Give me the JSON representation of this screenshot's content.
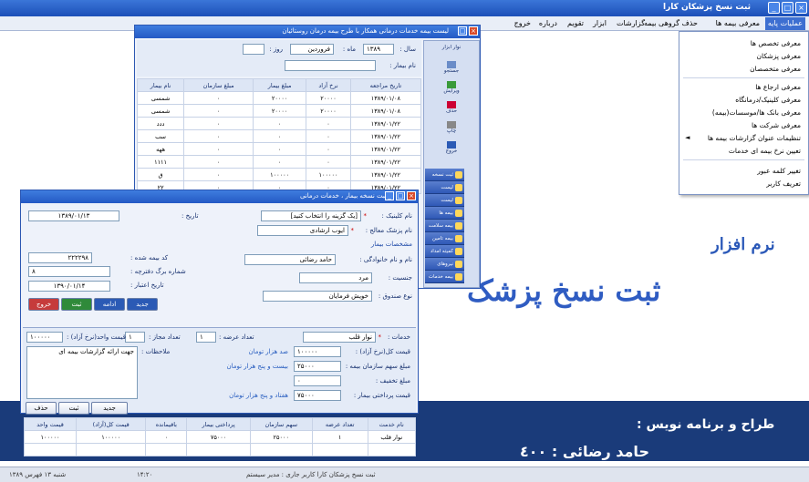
{
  "app": {
    "title": "ثبت نسخ پزشکان   کارا",
    "window_controls": [
      "_",
      "□",
      "×"
    ]
  },
  "menu": [
    "عملیات پایه",
    "معرفی بیمه ها",
    "حذف گروهی بیمه",
    "گزارشات",
    "ابزار",
    "تقویم",
    "درباره",
    "خروج"
  ],
  "dropdown": {
    "items": [
      "معرفی تخصص ها",
      "معرفی پزشکان",
      "معرفی متخصصان",
      "معرفی ارجاع ها",
      "معرفی کلینیک/درمانگاه",
      "معرفی بانک ها/موسسات(بیمه)",
      "معرفی شرکت ها",
      "تنظیمات عنوان گزارشات بیمه ها",
      "تعیین نرخ بیمه ای خدمات",
      "تغییر کلمه عبور",
      "تعریف کاربر"
    ]
  },
  "brand": {
    "line1": "نرم افزار",
    "line2": "ثبت نسخ پزشک"
  },
  "footer": {
    "designer_label": "طراح و برنامه نویس :",
    "designer_name": "حامد رضائی : ٤٠٠",
    "status_left": "شنبه ۱۳ فهرس ۱۳۸۹",
    "status_time": "۱۴:۲۰",
    "status_right": "ثبت نسخ پزشکان  کارا کاربر جاری : مدیر سیستم"
  },
  "back_window": {
    "title": "لیست بیمه خدمات درمانی همکار با طرح بیمه درمان روستائیان",
    "year_label": "سال :",
    "year_value": "۱۳۸۹",
    "month_label": "ماه :",
    "month_value": "فروردین",
    "day_label": "روز :",
    "name_label": "نام بیمار :",
    "columns": [
      "تاریخ مراجعه",
      "نرخ آزاد",
      "مبلغ بیمار",
      "مبلغ سازمان",
      "نام بیمار"
    ],
    "rows": [
      [
        "۱۳۸۹/۰۱/۰۸",
        "۲۰۰۰۰",
        "۲۰۰۰۰",
        "۰",
        "شمسی"
      ],
      [
        "۱۳۸۹/۰۱/۰۸",
        "۲۰۰۰۰",
        "۲۰۰۰۰",
        "۰",
        "شمسی"
      ],
      [
        "۱۳۸۹/۰۱/۲۲",
        "۰",
        "۰",
        "۰",
        "ددد"
      ],
      [
        "۱۳۸۹/۰۱/۲۲",
        "۰",
        "۰",
        "۰",
        "سب"
      ],
      [
        "۱۳۸۹/۰۱/۲۲",
        "۰",
        "۰",
        "۰",
        "ههه"
      ],
      [
        "۱۳۸۹/۰۱/۲۲",
        "۰",
        "۰",
        "۰",
        "۱۱۱۱"
      ],
      [
        "۱۳۸۹/۰۱/۲۲",
        "۱۰۰۰۰۰",
        "۱۰۰۰۰۰",
        "۰",
        "ق"
      ],
      [
        "۱۳۸۹/۰۱/۲۲",
        "۰",
        "۰",
        "۰",
        "۲۲"
      ]
    ],
    "side_items": [
      "نوار ابزار",
      "جستجو",
      "ویرایش",
      "حذف",
      "چاپ",
      "خروج"
    ],
    "nav_rows": [
      "ثبت نسخه جدید",
      "لیست بیماران",
      "لیست پزشکان",
      "بیمه ها",
      "بیمه سلامت",
      "بیمه تامین",
      "کمیته امداد",
      "نیروهای مسلح",
      "بیمه خدمات"
    ]
  },
  "front_window": {
    "title": "ثبت نسخه بیمار  ،  خدمات درمانی",
    "date_label": "تاریخ :",
    "date_value": "۱۳۸۹/۰۱/۱۳",
    "clinic_label": "نام کلینیک :",
    "clinic_value": "[یک گزینه را انتخاب کنید]",
    "doctor_label": "نام پزشک معالج :",
    "doctor_value": "ایوب ارشادی",
    "patient_section": "مشخصات بیمار",
    "insurance_code_label": "کد بیمه شده :",
    "insurance_code_value": "۲۲۲۲۹۸",
    "booklet_label": "شماره برگ دفترچه :",
    "booklet_value": "۸",
    "name_label": "نام و نام خانوادگی :",
    "name_value": "حامد رضائی",
    "validity_label": "تاریخ اعتبار :",
    "validity_value": "۱۳۹۰/۰۱/۱۴",
    "gender_label": "جنسیت :",
    "gender_value": "مرد",
    "fund_label": "نوع صندوق :",
    "fund_value": "خویش فرمایان",
    "btn_new": "جدید",
    "btn_edit": "ادامه",
    "btn_save": "ثبت",
    "btn_exit": "خروج",
    "services_label": "خدمات :",
    "service_value": "نوار قلب",
    "count_label": "تعداد عرضه :",
    "count_value": "۱",
    "approved_label": "تعداد مجاز :",
    "approved_value": "۱",
    "unit_price_label": "قیمت واحد(نرخ آزاد) :",
    "unit_price_value": "۱۰۰۰۰۰",
    "free_price_label": "قیمت کل(نرخ آزاد) :",
    "free_price_value": "۱۰۰۰۰۰",
    "free_price_words": "صد هزار تومان",
    "org_share_label": "مبلغ سهم سازمان بیمه :",
    "org_share_value": "۲۵۰۰۰",
    "org_share_words": "بیست و پنج هزار تومان",
    "discount_label": "مبلغ تخفیف :",
    "discount_value": "۰",
    "patient_pay_label": "قیمت پرداختی بیمار :",
    "patient_pay_value": "۷۵۰۰۰",
    "patient_pay_words": "هفتاد و پنج هزار تومان",
    "notes_label": "ملاحظات :",
    "notes_value": "جهت ارائه گزارشات بیمه ای",
    "btn_add": "جدید",
    "btn_record": "ثبت",
    "btn_delete": "حذف",
    "columns": [
      "نام خدمت",
      "تعداد عرضه",
      "سهم سازمان",
      "پرداختی بیمار",
      "باقیمانده",
      "قیمت کل(آزاد)",
      "قیمت واحد"
    ],
    "rows": [
      [
        "نوار قلب",
        "۱",
        "۲۵۰۰۰",
        "۷۵۰۰۰",
        "۰",
        "۱۰۰۰۰۰",
        "۱۰۰۰۰۰"
      ]
    ]
  }
}
